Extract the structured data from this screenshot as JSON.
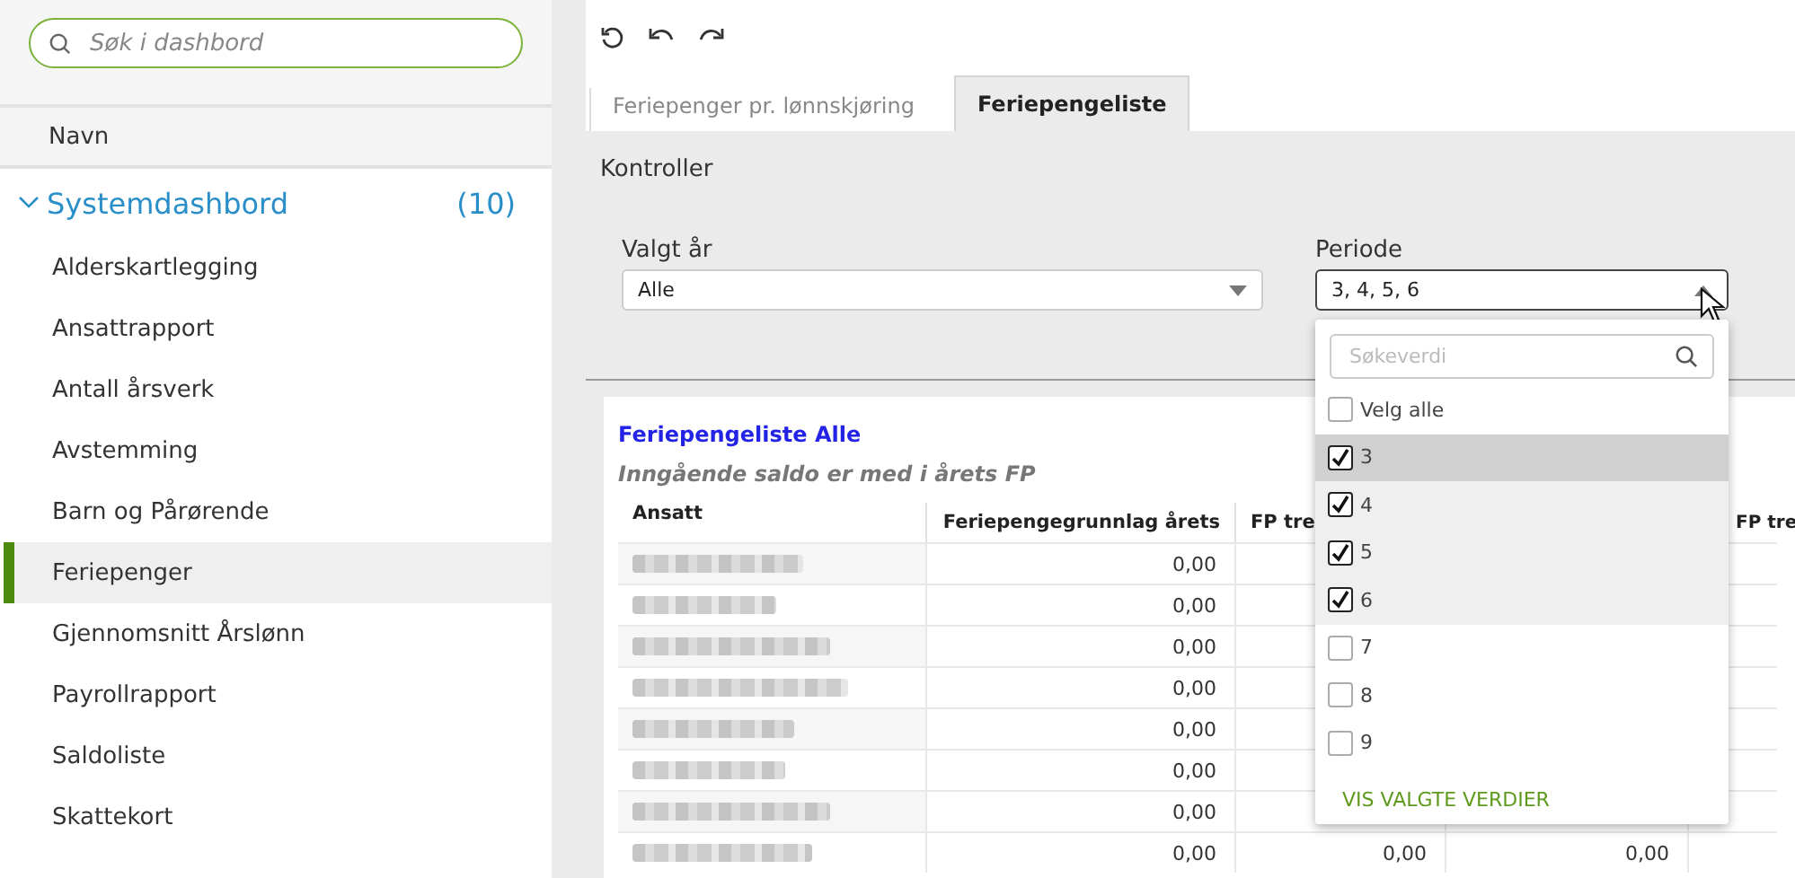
{
  "sidebar": {
    "search": {
      "placeholder": "Søk i dashbord"
    },
    "column_header": "Navn",
    "group": {
      "label": "Systemdashbord",
      "count": "(10)",
      "expanded": true,
      "items": [
        {
          "label": "Alderskartlegging",
          "selected": false
        },
        {
          "label": "Ansattrapport",
          "selected": false
        },
        {
          "label": "Antall årsverk",
          "selected": false
        },
        {
          "label": "Avstemming",
          "selected": false
        },
        {
          "label": "Barn og Pårørende",
          "selected": false
        },
        {
          "label": "Feriepenger",
          "selected": true
        },
        {
          "label": "Gjennomsnitt Årslønn",
          "selected": false
        },
        {
          "label": "Payrollrapport",
          "selected": false
        },
        {
          "label": "Saldoliste",
          "selected": false
        },
        {
          "label": "Skattekort",
          "selected": false
        }
      ]
    }
  },
  "tabs": [
    {
      "label": "Feriepenger pr. lønnskjøring",
      "selected": false
    },
    {
      "label": "Feriepengeliste",
      "selected": true
    }
  ],
  "controls": {
    "title": "Kontroller",
    "filters": [
      {
        "label": "Valgt år",
        "value": "Alle",
        "open": false
      },
      {
        "label": "Periode",
        "value": "3, 4, 5, 6",
        "open": true
      }
    ]
  },
  "dropdown": {
    "search_placeholder": "Søkeverdi",
    "select_all": {
      "label": "Velg alle",
      "checked": false
    },
    "options": [
      {
        "label": "3",
        "checked": true,
        "highlighted": true
      },
      {
        "label": "4",
        "checked": true,
        "highlighted": false
      },
      {
        "label": "5",
        "checked": true,
        "highlighted": false
      },
      {
        "label": "6",
        "checked": true,
        "highlighted": false
      },
      {
        "label": "7",
        "checked": false,
        "highlighted": false
      },
      {
        "label": "8",
        "checked": false,
        "highlighted": false
      },
      {
        "label": "9",
        "checked": false,
        "highlighted": false
      }
    ],
    "action": "VIS VALGTE VERDIER"
  },
  "report": {
    "title": "Feriepengeliste Alle",
    "subtitle": "Inngående saldo er med i årets FP",
    "columns": [
      {
        "label": "Ansatt"
      },
      {
        "label": "Feriepengegrunnlag årets"
      },
      {
        "label": "FP tre"
      },
      {},
      {
        "label": "FP tre"
      }
    ],
    "rows": [
      {
        "cells": [
          "",
          "0,00"
        ]
      },
      {
        "cells": [
          "",
          "0,00"
        ]
      },
      {
        "cells": [
          "",
          "0,00"
        ]
      },
      {
        "cells": [
          "",
          "0,00"
        ]
      },
      {
        "cells": [
          "",
          "0,00"
        ]
      },
      {
        "cells": [
          "",
          "0,00"
        ]
      },
      {
        "cells": [
          "",
          "0,00"
        ]
      },
      {
        "cells": [
          "",
          "0,00",
          "0,00",
          "0,00"
        ]
      }
    ]
  }
}
